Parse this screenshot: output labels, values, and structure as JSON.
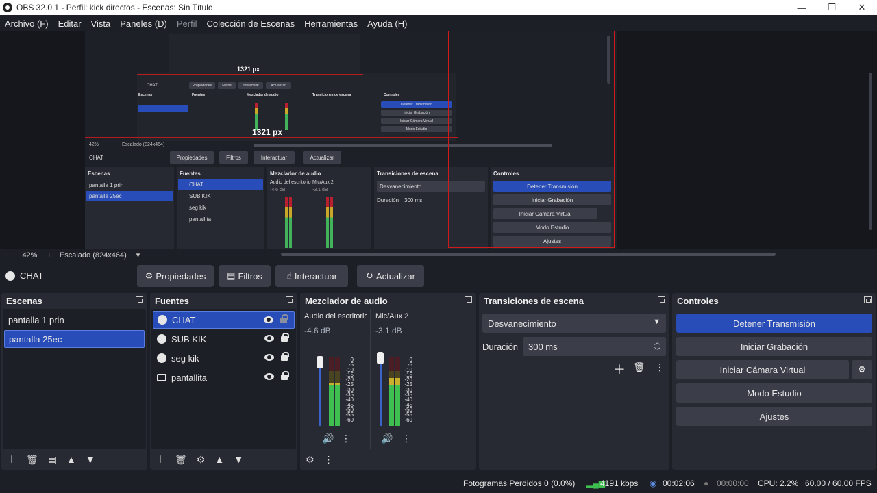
{
  "window": {
    "title": "OBS 32.0.1 - Perfil: kick directos - Escenas: Sin Título",
    "minimize": "—",
    "maximize": "❐",
    "close": "✕"
  },
  "menu": [
    "Archivo (F)",
    "Editar",
    "Vista",
    "Paneles (D)",
    "Perfil",
    "Colección de Escenas",
    "Herramientas",
    "Ayuda (H)"
  ],
  "preview": {
    "zoom": "42%",
    "zoom_minus": "−",
    "zoom_plus": "+",
    "scale": "Escalado (824x464)",
    "px_label_1": "1321 px",
    "px_label_2": "1321 px",
    "mini": {
      "source": "CHAT",
      "props": "Propiedades",
      "filters": "Filtros",
      "interact": "Interactuar",
      "refresh": "Actualizar",
      "scenes_hdr": "Escenas",
      "sources_hdr": "Fuentes",
      "mixer_hdr": "Mezclador de audio",
      "trans_hdr": "Transiciones de escena",
      "ctrl_hdr": "Controles",
      "scene1": "pantalla 1 prin",
      "scene2": "pantalla 25ec",
      "src1": "CHAT",
      "src2": "SUB KIK",
      "src3": "seg kik",
      "src4": "pantallita",
      "mix1": "Audio del escritorio",
      "mix2": "Mic/Aux 2",
      "db1": "-4.6 dB",
      "db2": "-3.1 dB",
      "fade": "Desvanecimiento",
      "dur_label": "Duración",
      "dur_val": "300 ms",
      "stop": "Detener Transmisión",
      "rec": "Iniciar Grabación",
      "vcam": "Iniciar Cámara Virtual",
      "studio": "Modo Estudio",
      "settings": "Ajustes"
    }
  },
  "source_toolbar": {
    "source_name": "CHAT",
    "properties": "Propiedades",
    "filters": "Filtros",
    "interact": "Interactuar",
    "refresh": "Actualizar"
  },
  "scenes": {
    "title": "Escenas",
    "items": [
      "pantalla 1 prin",
      "pantalla 25ec"
    ],
    "selected_index": 1
  },
  "sources": {
    "title": "Fuentes",
    "items": [
      {
        "name": "CHAT",
        "icon": "browser-icon",
        "locked": false
      },
      {
        "name": "SUB KIK",
        "icon": "browser-icon",
        "locked": true
      },
      {
        "name": "seg kik",
        "icon": "browser-icon",
        "locked": true
      },
      {
        "name": "pantallita",
        "icon": "display-icon",
        "locked": true
      }
    ],
    "selected_index": 0
  },
  "mixer": {
    "title": "Mezclador de audio",
    "channels": [
      {
        "name": "Audio del escritorio",
        "db": "-4.6 dB",
        "level": 0.62
      },
      {
        "name": "Mic/Aux 2",
        "db": "-3.1 dB",
        "level": 0.7
      }
    ],
    "scale": [
      "0",
      "-5",
      "-10",
      "-15",
      "-20",
      "-25",
      "-30",
      "-35",
      "-40",
      "-45",
      "-50",
      "-55",
      "-60"
    ]
  },
  "transitions": {
    "title": "Transiciones de escena",
    "selected": "Desvanecimiento",
    "duration_label": "Duración",
    "duration_value": "300 ms"
  },
  "controls": {
    "title": "Controles",
    "stop_stream": "Detener Transmisión",
    "start_recording": "Iniciar Grabación",
    "start_virtual_cam": "Iniciar Cámara Virtual",
    "studio_mode": "Modo Estudio",
    "settings": "Ajustes"
  },
  "status": {
    "dropped_frames": "Fotogramas Perdidos 0 (0.0%)",
    "bitrate": "4191 kbps",
    "stream_time": "00:02:06",
    "rec_time": "00:00:00",
    "cpu": "CPU: 2.2%",
    "fps": "60.00 / 60.00 FPS"
  },
  "colors": {
    "accent": "#284cb8",
    "red_outline": "#d11a1a",
    "panel": "#272a33",
    "background": "#1d1f26"
  }
}
